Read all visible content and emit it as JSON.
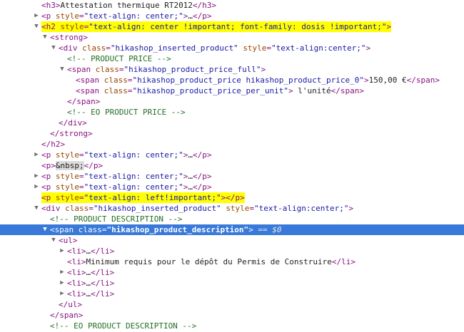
{
  "colors": {
    "tag": "#881280",
    "attr_name": "#994500",
    "attr_value": "#1a1aa6",
    "comment": "#236e25",
    "highlight": "#ffff00",
    "selection": "#3879d9"
  },
  "rows": [
    {
      "indent": 0,
      "arrow": null,
      "hl": false,
      "sel": false,
      "parts": [
        {
          "t": "tag",
          "v": "<h3>"
        },
        {
          "t": "txt",
          "v": "Attestation thermique RT2012"
        },
        {
          "t": "tag",
          "v": "</h3>"
        }
      ]
    },
    {
      "indent": 0,
      "arrow": "right",
      "hl": false,
      "sel": false,
      "parts": [
        {
          "t": "tag",
          "v": "<p"
        },
        {
          "t": "txt",
          "v": " "
        },
        {
          "t": "an",
          "v": "style"
        },
        {
          "t": "tag",
          "v": "="
        },
        {
          "t": "av",
          "v": "\"text-align: center;\""
        },
        {
          "t": "tag",
          "v": ">"
        },
        {
          "t": "txt",
          "v": "…"
        },
        {
          "t": "tag",
          "v": "</p>"
        }
      ]
    },
    {
      "indent": 0,
      "arrow": "down",
      "hl": true,
      "sel": false,
      "parts": [
        {
          "t": "tag",
          "v": "<h2"
        },
        {
          "t": "txt",
          "v": " "
        },
        {
          "t": "an",
          "v": "style"
        },
        {
          "t": "tag",
          "v": "="
        },
        {
          "t": "av",
          "v": "\"text-align: center !important; font-family: dosis !important;\""
        },
        {
          "t": "tag",
          "v": ">"
        }
      ]
    },
    {
      "indent": 1,
      "arrow": "down",
      "hl": false,
      "sel": false,
      "parts": [
        {
          "t": "tag",
          "v": "<strong>"
        }
      ]
    },
    {
      "indent": 2,
      "arrow": "down",
      "hl": false,
      "sel": false,
      "parts": [
        {
          "t": "tag",
          "v": "<div"
        },
        {
          "t": "txt",
          "v": " "
        },
        {
          "t": "an",
          "v": "class"
        },
        {
          "t": "tag",
          "v": "="
        },
        {
          "t": "av",
          "v": "\"hikashop_inserted_product\""
        },
        {
          "t": "txt",
          "v": " "
        },
        {
          "t": "an",
          "v": "style"
        },
        {
          "t": "tag",
          "v": "="
        },
        {
          "t": "av",
          "v": "\"text-align:center;\""
        },
        {
          "t": "tag",
          "v": ">"
        }
      ]
    },
    {
      "indent": 3,
      "arrow": null,
      "hl": false,
      "sel": false,
      "parts": [
        {
          "t": "cm",
          "v": "<!-- PRODUCT PRICE -->"
        }
      ]
    },
    {
      "indent": 3,
      "arrow": "down",
      "hl": false,
      "sel": false,
      "parts": [
        {
          "t": "tag",
          "v": "<span"
        },
        {
          "t": "txt",
          "v": " "
        },
        {
          "t": "an",
          "v": "class"
        },
        {
          "t": "tag",
          "v": "="
        },
        {
          "t": "av",
          "v": "\"hikashop_product_price_full\""
        },
        {
          "t": "tag",
          "v": ">"
        }
      ]
    },
    {
      "indent": 4,
      "arrow": null,
      "hl": false,
      "sel": false,
      "parts": [
        {
          "t": "tag",
          "v": "<span"
        },
        {
          "t": "txt",
          "v": " "
        },
        {
          "t": "an",
          "v": "class"
        },
        {
          "t": "tag",
          "v": "="
        },
        {
          "t": "av",
          "v": "\"hikashop_product_price hikashop_product_price_0\""
        },
        {
          "t": "tag",
          "v": ">"
        },
        {
          "t": "txt",
          "v": "150,00 €"
        },
        {
          "t": "tag",
          "v": "</span>"
        }
      ]
    },
    {
      "indent": 4,
      "arrow": null,
      "hl": false,
      "sel": false,
      "parts": [
        {
          "t": "tag",
          "v": "<span"
        },
        {
          "t": "txt",
          "v": " "
        },
        {
          "t": "an",
          "v": "class"
        },
        {
          "t": "tag",
          "v": "="
        },
        {
          "t": "av",
          "v": "\"hikashop_product_price_per_unit\""
        },
        {
          "t": "tag",
          "v": ">"
        },
        {
          "t": "txt",
          "v": " l'unité"
        },
        {
          "t": "tag",
          "v": "</span>"
        }
      ]
    },
    {
      "indent": 3,
      "arrow": null,
      "hl": false,
      "sel": false,
      "parts": [
        {
          "t": "tag",
          "v": "</span>"
        }
      ]
    },
    {
      "indent": 3,
      "arrow": null,
      "hl": false,
      "sel": false,
      "parts": [
        {
          "t": "cm",
          "v": "<!-- EO PRODUCT PRICE -->"
        }
      ]
    },
    {
      "indent": 2,
      "arrow": null,
      "hl": false,
      "sel": false,
      "parts": [
        {
          "t": "tag",
          "v": "</div>"
        }
      ]
    },
    {
      "indent": 1,
      "arrow": null,
      "hl": false,
      "sel": false,
      "parts": [
        {
          "t": "tag",
          "v": "</strong>"
        }
      ]
    },
    {
      "indent": 0,
      "arrow": null,
      "hl": false,
      "sel": false,
      "parts": [
        {
          "t": "tag",
          "v": "</h2>"
        }
      ]
    },
    {
      "indent": 0,
      "arrow": "right",
      "hl": false,
      "sel": false,
      "parts": [
        {
          "t": "tag",
          "v": "<p"
        },
        {
          "t": "txt",
          "v": " "
        },
        {
          "t": "an",
          "v": "style"
        },
        {
          "t": "tag",
          "v": "="
        },
        {
          "t": "av",
          "v": "\"text-align: center;\""
        },
        {
          "t": "tag",
          "v": ">"
        },
        {
          "t": "txt",
          "v": "…"
        },
        {
          "t": "tag",
          "v": "</p>"
        }
      ]
    },
    {
      "indent": 0,
      "arrow": null,
      "hl": false,
      "sel": false,
      "parts": [
        {
          "t": "tag",
          "v": "<p>"
        },
        {
          "t": "ent",
          "v": "&nbsp;"
        },
        {
          "t": "tag",
          "v": "</p>"
        }
      ]
    },
    {
      "indent": 0,
      "arrow": "right",
      "hl": false,
      "sel": false,
      "parts": [
        {
          "t": "tag",
          "v": "<p"
        },
        {
          "t": "txt",
          "v": " "
        },
        {
          "t": "an",
          "v": "style"
        },
        {
          "t": "tag",
          "v": "="
        },
        {
          "t": "av",
          "v": "\"text-align: center;\""
        },
        {
          "t": "tag",
          "v": ">"
        },
        {
          "t": "txt",
          "v": "…"
        },
        {
          "t": "tag",
          "v": "</p>"
        }
      ]
    },
    {
      "indent": 0,
      "arrow": "right",
      "hl": false,
      "sel": false,
      "parts": [
        {
          "t": "tag",
          "v": "<p"
        },
        {
          "t": "txt",
          "v": " "
        },
        {
          "t": "an",
          "v": "style"
        },
        {
          "t": "tag",
          "v": "="
        },
        {
          "t": "av",
          "v": "\"text-align: center;\""
        },
        {
          "t": "tag",
          "v": ">"
        },
        {
          "t": "txt",
          "v": "…"
        },
        {
          "t": "tag",
          "v": "</p>"
        }
      ]
    },
    {
      "indent": 0,
      "arrow": null,
      "hl": true,
      "sel": false,
      "parts": [
        {
          "t": "tag",
          "v": "<p"
        },
        {
          "t": "txt",
          "v": " "
        },
        {
          "t": "an",
          "v": "style"
        },
        {
          "t": "tag",
          "v": "="
        },
        {
          "t": "av",
          "v": "\"text-align: left!important;\""
        },
        {
          "t": "tag",
          "v": "></p>"
        }
      ]
    },
    {
      "indent": 0,
      "arrow": "down",
      "hl": false,
      "sel": false,
      "parts": [
        {
          "t": "tag",
          "v": "<div"
        },
        {
          "t": "txt",
          "v": " "
        },
        {
          "t": "an",
          "v": "class"
        },
        {
          "t": "tag",
          "v": "="
        },
        {
          "t": "av",
          "v": "\"hikashop_inserted_product\""
        },
        {
          "t": "txt",
          "v": " "
        },
        {
          "t": "an",
          "v": "style"
        },
        {
          "t": "tag",
          "v": "="
        },
        {
          "t": "av",
          "v": "\"text-align:center;\""
        },
        {
          "t": "tag",
          "v": ">"
        }
      ]
    },
    {
      "indent": 1,
      "arrow": null,
      "hl": false,
      "sel": false,
      "parts": [
        {
          "t": "cm",
          "v": "<!-- PRODUCT DESCRIPTION -->"
        }
      ]
    },
    {
      "indent": 1,
      "arrow": "down",
      "hl": false,
      "sel": true,
      "parts": [
        {
          "t": "tag",
          "v": "<span"
        },
        {
          "t": "txt",
          "v": " "
        },
        {
          "t": "an",
          "v": "class"
        },
        {
          "t": "tag",
          "v": "="
        },
        {
          "t": "av",
          "v": "\"hikashop_product_description\""
        },
        {
          "t": "tag",
          "v": ">"
        },
        {
          "t": "eq",
          "v": " == "
        },
        {
          "t": "dollar",
          "v": "$0"
        }
      ]
    },
    {
      "indent": 2,
      "arrow": "down",
      "hl": false,
      "sel": false,
      "parts": [
        {
          "t": "tag",
          "v": "<ul>"
        }
      ]
    },
    {
      "indent": 3,
      "arrow": "right",
      "hl": false,
      "sel": false,
      "parts": [
        {
          "t": "tag",
          "v": "<li>"
        },
        {
          "t": "txt",
          "v": "…"
        },
        {
          "t": "tag",
          "v": "</li>"
        }
      ]
    },
    {
      "indent": 3,
      "arrow": null,
      "hl": false,
      "sel": false,
      "parts": [
        {
          "t": "tag",
          "v": "<li>"
        },
        {
          "t": "txt",
          "v": "Minimum requis pour le dépôt du Permis de Construire"
        },
        {
          "t": "tag",
          "v": "</li>"
        }
      ]
    },
    {
      "indent": 3,
      "arrow": "right",
      "hl": false,
      "sel": false,
      "parts": [
        {
          "t": "tag",
          "v": "<li>"
        },
        {
          "t": "txt",
          "v": "…"
        },
        {
          "t": "tag",
          "v": "</li>"
        }
      ]
    },
    {
      "indent": 3,
      "arrow": "right",
      "hl": false,
      "sel": false,
      "parts": [
        {
          "t": "tag",
          "v": "<li>"
        },
        {
          "t": "txt",
          "v": "…"
        },
        {
          "t": "tag",
          "v": "</li>"
        }
      ]
    },
    {
      "indent": 3,
      "arrow": "right",
      "hl": false,
      "sel": false,
      "parts": [
        {
          "t": "tag",
          "v": "<li>"
        },
        {
          "t": "txt",
          "v": "…"
        },
        {
          "t": "tag",
          "v": "</li>"
        }
      ]
    },
    {
      "indent": 2,
      "arrow": null,
      "hl": false,
      "sel": false,
      "parts": [
        {
          "t": "tag",
          "v": "</ul>"
        }
      ]
    },
    {
      "indent": 1,
      "arrow": null,
      "hl": false,
      "sel": false,
      "parts": [
        {
          "t": "tag",
          "v": "</span>"
        }
      ]
    },
    {
      "indent": 1,
      "arrow": null,
      "hl": false,
      "sel": false,
      "parts": [
        {
          "t": "cm",
          "v": "<!-- EO PRODUCT DESCRIPTION -->"
        }
      ]
    }
  ]
}
